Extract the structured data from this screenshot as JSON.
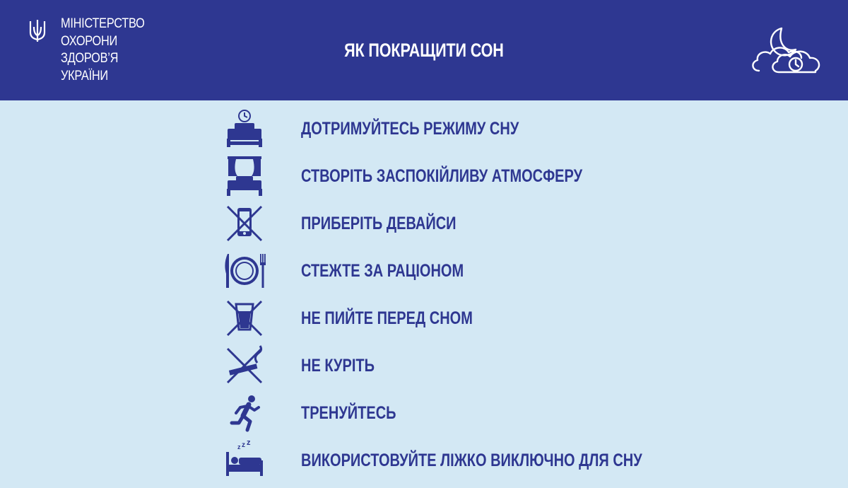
{
  "header": {
    "ministry_lines": [
      "МІНІСТЕРСТВО",
      "ОХОРОНИ",
      "ЗДОРОВ’Я",
      "УКРАЇНИ"
    ],
    "title": "ЯК ПОКРАЩИТИ СОН"
  },
  "tips": [
    {
      "icon": "bed-clock-icon",
      "label": "ДОТРИМУЙТЕСЬ РЕЖИМУ СНУ"
    },
    {
      "icon": "bed-curtains-icon",
      "label": "СТВОРІТЬ ЗАСПОКІЙЛИВУ АТМОСФЕРУ"
    },
    {
      "icon": "no-phone-icon",
      "label": "ПРИБЕРІТЬ ДЕВАЙСИ"
    },
    {
      "icon": "plate-cutlery-icon",
      "label": "СТЕЖТЕ ЗА РАЦІОНОМ"
    },
    {
      "icon": "no-drink-icon",
      "label": "НЕ ПИЙТЕ ПЕРЕД СНОМ"
    },
    {
      "icon": "no-smoking-icon",
      "label": "НЕ КУРІТЬ"
    },
    {
      "icon": "running-person-icon",
      "label": "ТРЕНУЙТЕСЬ"
    },
    {
      "icon": "sleeping-bed-icon",
      "label": "ВИКОРИСТОВУЙТЕ ЛІЖКО ВИКЛЮЧНО ДЛЯ СНУ"
    }
  ],
  "colors": {
    "header_bg": "#2e3791",
    "page_bg": "#d3e8f4",
    "accent": "#2e3791"
  }
}
